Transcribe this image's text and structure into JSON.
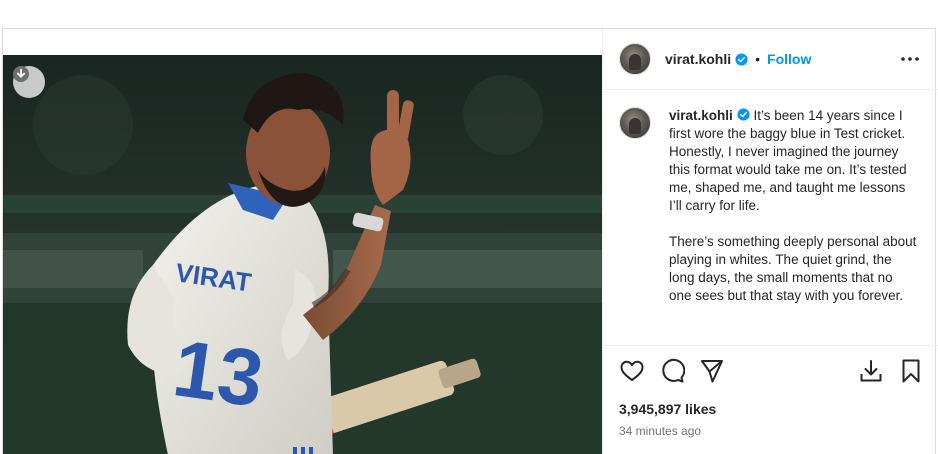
{
  "post": {
    "username": "virat.kohli",
    "follow_label": "Follow",
    "separator": "•",
    "caption_p1": " It’s been 14 years since I first wore the baggy blue in Test cricket. Honestly, I never imagined the journey this format would take me on. It’s tested me, shaped me, and taught me lessons I’ll carry for life.",
    "caption_p2": "There’s something deeply personal about playing in whites. The quiet grind, the long days, the small moments that no one sees but that stay with you forever.",
    "likes": "3,945,897 likes",
    "time_ago": "34 minutes ago"
  },
  "photo": {
    "jersey_name": "VIRAT",
    "jersey_number": "13"
  },
  "icons": {
    "verified": "verified-badge-icon",
    "more": "more-options-icon",
    "like": "heart-icon",
    "comment": "comment-icon",
    "share": "share-icon",
    "download": "download-icon",
    "save": "bookmark-icon"
  },
  "colors": {
    "accent": "#0095f6",
    "text": "#262626",
    "muted": "#737373"
  }
}
